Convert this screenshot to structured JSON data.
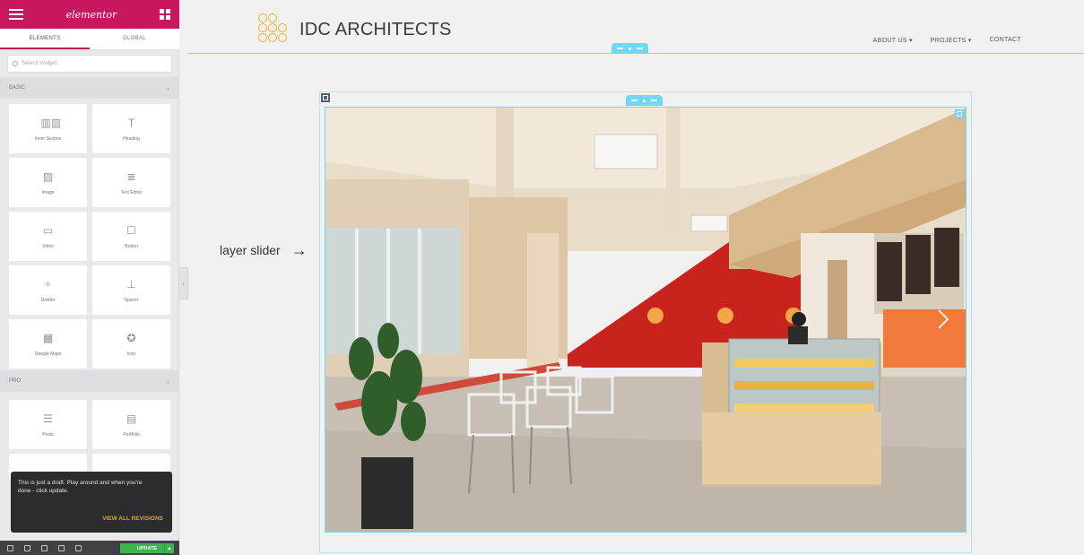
{
  "sidebar": {
    "brand": "elementor",
    "tabs": [
      {
        "label": "ELEMENTS"
      },
      {
        "label": "GLOBAL"
      }
    ],
    "search": {
      "placeholder": "Search Widget..."
    },
    "sections": [
      {
        "label": "BASIC",
        "widgets": [
          {
            "label": "Inner Section",
            "icon": "columns-icon"
          },
          {
            "label": "Heading",
            "icon": "heading-icon"
          },
          {
            "label": "Image",
            "icon": "image-icon"
          },
          {
            "label": "Text Editor",
            "icon": "text-editor-icon"
          },
          {
            "label": "Video",
            "icon": "video-icon"
          },
          {
            "label": "Button",
            "icon": "button-icon"
          },
          {
            "label": "Divider",
            "icon": "divider-icon"
          },
          {
            "label": "Spacer",
            "icon": "spacer-icon"
          },
          {
            "label": "Google Maps",
            "icon": "map-icon"
          },
          {
            "label": "Icon",
            "icon": "star-icon"
          }
        ]
      },
      {
        "label": "PRO",
        "widgets": [
          {
            "label": "Posts",
            "icon": "posts-icon"
          },
          {
            "label": "Portfolio",
            "icon": "portfolio-icon"
          }
        ]
      }
    ],
    "toast": {
      "message": "This is just a draft. Play around and when you're done - click update.",
      "link": "VIEW ALL REVISIONS"
    },
    "footer": {
      "update_label": "UPDATE"
    }
  },
  "site": {
    "title": "IDC ARCHITECTS",
    "nav": [
      {
        "label": "ABOUT US ▾"
      },
      {
        "label": "PROJECTS ▾"
      },
      {
        "label": "CONTACT"
      }
    ]
  },
  "annotation": {
    "text": "layer slider",
    "arrow": "→"
  },
  "colors": {
    "brand": "#c7175f",
    "editor_accent": "#71d7f7",
    "logo": "#f2b120",
    "update": "#39b54a",
    "revision_link": "#d6a82b"
  }
}
